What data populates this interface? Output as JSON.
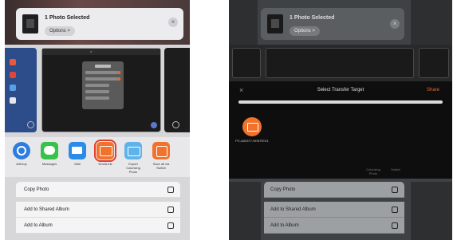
{
  "left": {
    "share_title": "1 Photo Selected",
    "options_label": "Options >",
    "close_glyph": "×",
    "preview_dialog_title": "Settings",
    "apps": [
      {
        "label": "AirDrop",
        "icon": "airdrop-icon"
      },
      {
        "label": "Messages",
        "icon": "messages-icon"
      },
      {
        "label": "Mail",
        "icon": "mail-icon"
      },
      {
        "label": "EnvisLink",
        "icon": "ezcast-icon"
      },
      {
        "label": "Export Colorizing Photo",
        "icon": "export-icon"
      },
      {
        "label": "Save all via Switch",
        "icon": "switch-icon"
      }
    ],
    "actions": [
      {
        "label": "Copy Photo",
        "icon": "copy-icon"
      },
      {
        "label": "Add to Shared Album",
        "icon": "shared-album-icon"
      },
      {
        "label": "Add to Album",
        "icon": "album-icon"
      }
    ]
  },
  "right": {
    "share_title": "1 Photo Selected",
    "options_label": "Options >",
    "close_glyph": "×",
    "transfer": {
      "close_glyph": "×",
      "title": "Select Transfer Target",
      "share_label": "Share",
      "device_label": "PC-A00377-HISHTEX1"
    },
    "apps_labels": [
      "Colorizing Photo",
      "Switch"
    ],
    "actions": [
      {
        "label": "Copy Photo",
        "icon": "copy-icon"
      },
      {
        "label": "Add to Shared Album",
        "icon": "shared-album-icon"
      },
      {
        "label": "Add to Album",
        "icon": "album-icon"
      }
    ]
  },
  "colors": {
    "accent_orange": "#f2722b",
    "highlight_red": "#e43c2c",
    "dark_overlay": "#0e0e0e"
  }
}
